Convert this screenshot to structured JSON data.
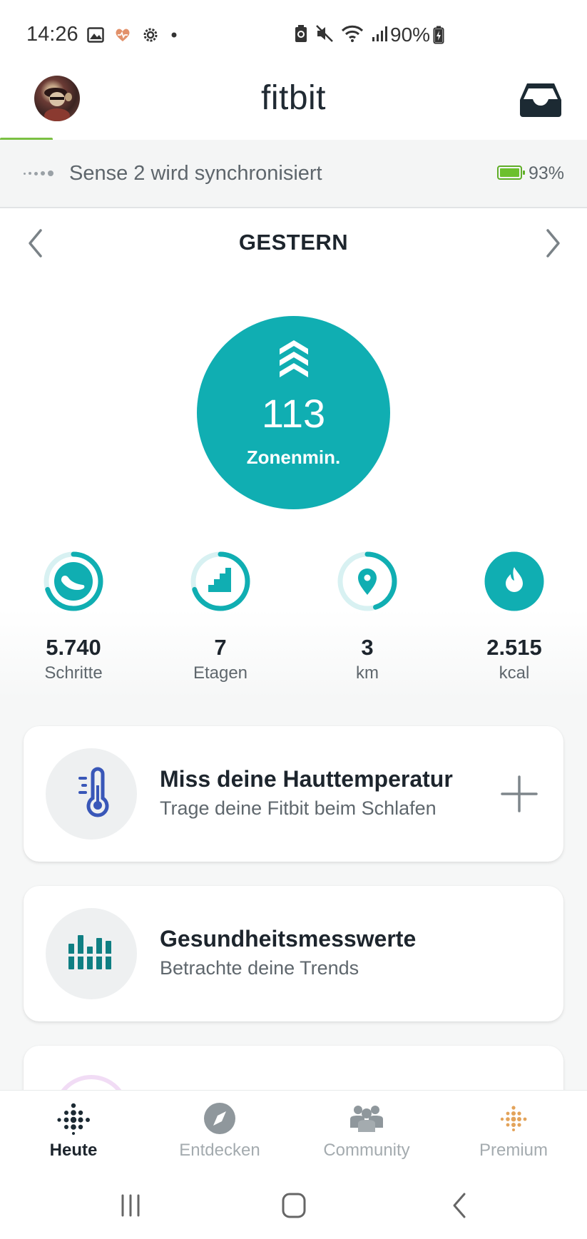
{
  "status_bar": {
    "time": "14:26",
    "battery_percent": "90%",
    "icons": [
      "image-icon",
      "heart-icon",
      "settings-icon",
      "dot-icon",
      "battery-saver-icon",
      "mute-icon",
      "wifi-icon",
      "signal-icon",
      "charging-battery-icon"
    ]
  },
  "header": {
    "app_title": "fitbit",
    "avatar": "avatar",
    "inbox_icon": "inbox-icon"
  },
  "sync": {
    "text": "Sense 2 wird synchronisiert",
    "device_battery": "93%",
    "colors": {
      "progress": "#7bc043",
      "battery": "#6cc02d"
    }
  },
  "day": {
    "title": "GESTERN"
  },
  "zone": {
    "value": "113",
    "label": "Zonenmin.",
    "color": "#10aeb2"
  },
  "stats": [
    {
      "id": "steps",
      "value": "5.740",
      "label": "Schritte",
      "icon": "shoe-icon",
      "progress": 0.7
    },
    {
      "id": "floors",
      "value": "7",
      "label": "Etagen",
      "icon": "stairs-icon",
      "progress": 0.7
    },
    {
      "id": "distance",
      "value": "3",
      "label": "km",
      "icon": "location-pin-icon",
      "progress": 0.45
    },
    {
      "id": "calories",
      "value": "2.515",
      "label": "kcal",
      "icon": "flame-icon",
      "progress": 1.0
    }
  ],
  "cards": [
    {
      "title": "Miss deine Hauttemperatur",
      "subtitle": "Trage deine Fitbit beim Schlafen",
      "icon": "thermometer-icon",
      "action": "plus-icon"
    },
    {
      "title": "Gesundheitsmesswerte",
      "subtitle": "Betrachte deine Trends",
      "icon": "health-metrics-icon"
    }
  ],
  "bottom_nav": {
    "tabs": [
      {
        "label": "Heute",
        "icon": "fitbit-dots-icon",
        "active": true
      },
      {
        "label": "Entdecken",
        "icon": "compass-icon",
        "active": false
      },
      {
        "label": "Community",
        "icon": "community-icon",
        "active": false
      },
      {
        "label": "Premium",
        "icon": "premium-icon",
        "active": false
      }
    ]
  },
  "system_nav": [
    "recents-button",
    "home-button",
    "back-button"
  ]
}
